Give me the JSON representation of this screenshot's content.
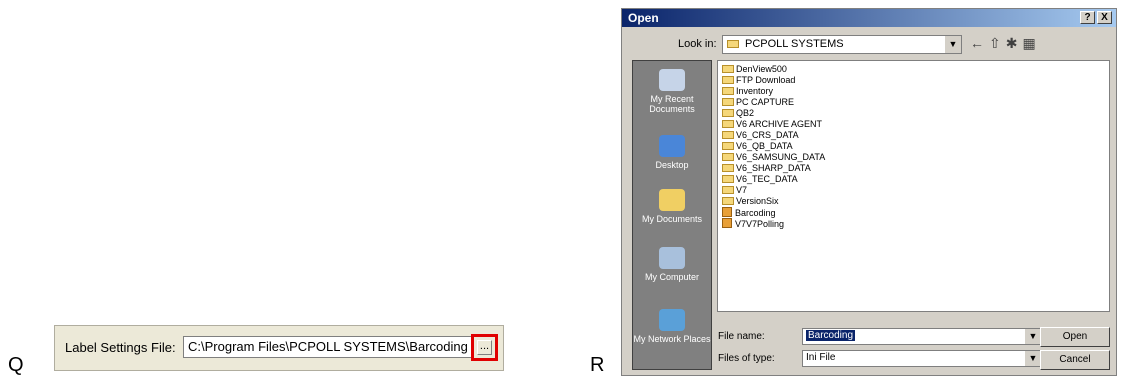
{
  "panel_q": {
    "letter": "Q",
    "label": "Label Settings File:",
    "path_value": "C:\\Program Files\\PCPOLL SYSTEMS\\Barcoding",
    "browse_label": "...",
    "highlight_color": "#e00000"
  },
  "panel_r": {
    "letter": "R",
    "dialog": {
      "title": "Open",
      "help_button": "?",
      "close_button": "X",
      "look_in_label": "Look in:",
      "look_in_value": "PCPOLL SYSTEMS",
      "places": [
        {
          "label": "My Recent Documents",
          "icon": "recent-documents-icon"
        },
        {
          "label": "Desktop",
          "icon": "desktop-icon"
        },
        {
          "label": "My Documents",
          "icon": "my-documents-icon"
        },
        {
          "label": "My Computer",
          "icon": "my-computer-icon"
        },
        {
          "label": "My Network Places",
          "icon": "network-places-icon"
        }
      ],
      "files": [
        {
          "name": "DenView500",
          "type": "folder"
        },
        {
          "name": "FTP Download",
          "type": "folder"
        },
        {
          "name": "Inventory",
          "type": "folder"
        },
        {
          "name": "PC CAPTURE",
          "type": "folder"
        },
        {
          "name": "QB2",
          "type": "folder"
        },
        {
          "name": "V6 ARCHIVE AGENT",
          "type": "folder"
        },
        {
          "name": "V6_CRS_DATA",
          "type": "folder"
        },
        {
          "name": "V6_QB_DATA",
          "type": "folder"
        },
        {
          "name": "V6_SAMSUNG_DATA",
          "type": "folder"
        },
        {
          "name": "V6_SHARP_DATA",
          "type": "folder"
        },
        {
          "name": "V6_TEC_DATA",
          "type": "folder"
        },
        {
          "name": "V7",
          "type": "folder"
        },
        {
          "name": "VersionSix",
          "type": "folder"
        },
        {
          "name": "Barcoding",
          "type": "ini"
        },
        {
          "name": "V7V7Polling",
          "type": "ini"
        }
      ],
      "file_name_label": "File name:",
      "file_name_value": "Barcoding",
      "files_of_type_label": "Files of type:",
      "files_of_type_value": "Ini File",
      "open_button": "Open",
      "cancel_button": "Cancel"
    }
  }
}
